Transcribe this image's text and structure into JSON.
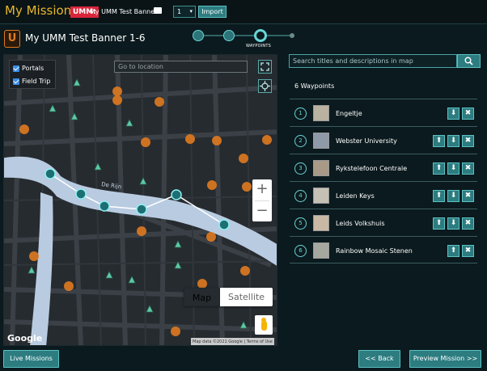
{
  "topbar": {
    "app_title": "My Missions",
    "umm_tag": "UMM:",
    "banner_name": "My UMM Test Banner",
    "mission_number": "1",
    "import_label": "Import"
  },
  "mission": {
    "logo_letter": "U",
    "title": "My UMM Test Banner 1-6"
  },
  "steps": {
    "current_label": "WAYPOINTS"
  },
  "map": {
    "layers": [
      {
        "label": "Portals",
        "checked": true
      },
      {
        "label": "Field Trip",
        "checked": true
      }
    ],
    "go_location_placeholder": "Go to location",
    "zoom_in": "+",
    "zoom_out": "−",
    "type_map": "Map",
    "type_satellite": "Satellite",
    "google_logo": "Google",
    "attribution": "Map data ©2021 Google | Terms of Use",
    "street_labels": [
      "De Rijn"
    ]
  },
  "search": {
    "placeholder": "Search titles and descriptions in map"
  },
  "waypoints": {
    "count_label": "6 Waypoints",
    "items": [
      {
        "num": "1",
        "name": "Engeltje"
      },
      {
        "num": "2",
        "name": "Webster University"
      },
      {
        "num": "3",
        "name": "Rykstelefoon Centrale"
      },
      {
        "num": "4",
        "name": "Leiden Keys"
      },
      {
        "num": "5",
        "name": "Leids Volkshuis"
      },
      {
        "num": "6",
        "name": "Rainbow Mosaic Stenen"
      }
    ]
  },
  "footer": {
    "live_missions": "Live Missions",
    "back": "<< Back",
    "preview": "Preview Mission >>"
  },
  "colors": {
    "accent": "#6ad4d6",
    "title": "#e8b82a",
    "button": "#2c7c80",
    "umm_red": "#d8253a"
  }
}
